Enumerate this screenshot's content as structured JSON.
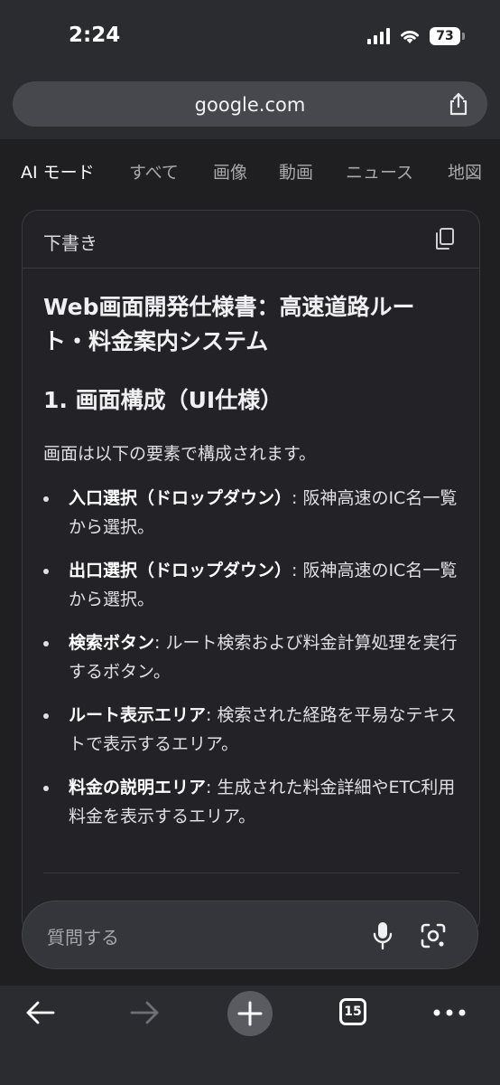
{
  "status_bar": {
    "time": "2:24",
    "battery": "73"
  },
  "browser": {
    "url": "google.com"
  },
  "tabs": [
    {
      "label": "AI モード",
      "active": true
    },
    {
      "label": "すべて"
    },
    {
      "label": "画像"
    },
    {
      "label": "動画"
    },
    {
      "label": "ニュース"
    },
    {
      "label": "地図"
    }
  ],
  "draft": {
    "header": "下書き",
    "title": "Web画面開発仕様書：高速道路ルート・料金案内システム",
    "section_heading": "1. 画面構成（UI仕様）",
    "intro": "画面は以下の要素で構成されます。",
    "items": [
      {
        "term": "入口選択（ドロップダウン）",
        "desc": ": 阪神高速のIC名一覧から選択。"
      },
      {
        "term": "出口選択（ドロップダウン）",
        "desc": ": 阪神高速のIC名一覧から選択。"
      },
      {
        "term": "検索ボタン",
        "desc": ": ルート検索および料金計算処理を実行するボタン。"
      },
      {
        "term": "ルート表示エリア",
        "desc": ": 検索された経路を平易なテキストで表示するエリア。"
      },
      {
        "term": "料金の説明エリア",
        "desc": ": 生成された料金詳細やETC利用料金を表示するエリア。"
      }
    ]
  },
  "query": {
    "placeholder": "質問する"
  },
  "toolbar": {
    "tab_count": "15"
  },
  "icons": [
    "share-icon",
    "copy-icon",
    "mic-icon",
    "lens-icon",
    "back-icon",
    "forward-icon",
    "plus-icon",
    "tabs-icon",
    "more-icon"
  ]
}
